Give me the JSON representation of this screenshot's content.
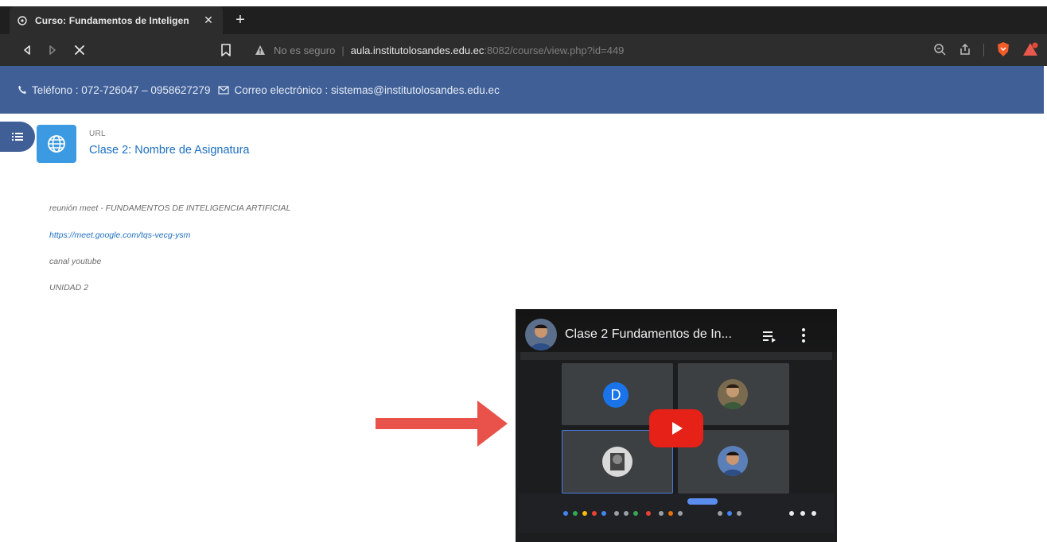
{
  "browser": {
    "tab_title": "Curso: Fundamentos de Inteligen",
    "insecure_label": "No es seguro",
    "url_host": "aula.institutolosandes.edu.ec",
    "url_path": ":8082/course/view.php?id=449"
  },
  "contact": {
    "phone": "Teléfono : 072-726047 – 0958627279",
    "email": "Correo electrónico : sistemas@institutolosandes.edu.ec"
  },
  "activity": {
    "type_label": "URL",
    "title": "Clase 2: Nombre de Asignatura"
  },
  "description": {
    "line1": "reunión meet - FUNDAMENTOS DE INTELIGENCIA ARTIFICIAL",
    "link": "https://meet.google.com/tqs-vecg-ysm",
    "line3": "canal youtube",
    "line4": "UNIDAD 2"
  },
  "video": {
    "title": "Clase 2 Fundamentos de In...",
    "participant_initial": "D"
  },
  "colors": {
    "header_blue": "#3f5f96",
    "link_blue": "#1d6fc2",
    "arrow_red": "#e8524a",
    "youtube_red": "#e62117"
  }
}
